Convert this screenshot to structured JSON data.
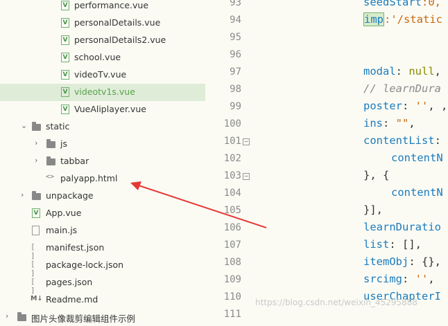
{
  "tree": {
    "items": [
      {
        "label": "performance.vue",
        "icon": "vue-file-icon"
      },
      {
        "label": "personalDetails.vue",
        "icon": "vue-file-icon"
      },
      {
        "label": "personalDetails2.vue",
        "icon": "vue-file-icon"
      },
      {
        "label": "school.vue",
        "icon": "vue-file-icon"
      },
      {
        "label": "videoTv.vue",
        "icon": "vue-file-icon"
      },
      {
        "label": "videotv1s.vue",
        "icon": "vue-file-icon",
        "selected": true
      },
      {
        "label": "VueAliplayer.vue",
        "icon": "vue-file-icon"
      },
      {
        "label": "static",
        "icon": "folder-icon",
        "expanded": true
      },
      {
        "label": "js",
        "icon": "folder-icon"
      },
      {
        "label": "tabbar",
        "icon": "folder-icon"
      },
      {
        "label": "palyapp.html",
        "icon": "html-file-icon"
      },
      {
        "label": "unpackage",
        "icon": "folder-icon"
      },
      {
        "label": "App.vue",
        "icon": "vue-file-icon"
      },
      {
        "label": "main.js",
        "icon": "js-file-icon"
      },
      {
        "label": "manifest.json",
        "icon": "json-file-icon"
      },
      {
        "label": "package-lock.json",
        "icon": "json-file-icon"
      },
      {
        "label": "pages.json",
        "icon": "json-file-icon"
      },
      {
        "label": "Readme.md",
        "icon": "markdown-file-icon"
      },
      {
        "label": "图片头像裁剪编辑组件示例",
        "icon": "folder-icon"
      }
    ]
  },
  "editor": {
    "line_numbers": [
      "93",
      "94",
      "95",
      "96",
      "97",
      "98",
      "99",
      "100",
      "101",
      "102",
      "103",
      "104",
      "105",
      "106",
      "107",
      "108",
      "109",
      "110",
      "111"
    ],
    "code": {
      "l93a": "seedStart",
      "l93b": ":0,",
      "l94a": "imp",
      "l94b": ":'/static",
      "l97a": "modal",
      "l97b": ": ",
      "l97c": "null",
      "l97d": ",",
      "l98": "// learnDura",
      "l99a": "poster",
      "l99b": ": ",
      "l99c": "''",
      "l99d": ", ,",
      "l100a": "ins",
      "l100b": ": ",
      "l100c": "\"\"",
      "l100d": ",",
      "l101a": "contentList",
      "l101b": ":",
      "l102": "contentN",
      "l103": "}, {",
      "l104": "contentN",
      "l105": "}],",
      "l106": "learnDuratio",
      "l107a": "list",
      "l107b": ": [],",
      "l108a": "itemObj",
      "l108b": ": {},",
      "l109a": "srcimg",
      "l109b": ": ",
      "l109c": "''",
      "l109d": ",",
      "l110": "userChapterI"
    }
  },
  "watermark": "https://blog.csdn.net/weixin_45295888"
}
